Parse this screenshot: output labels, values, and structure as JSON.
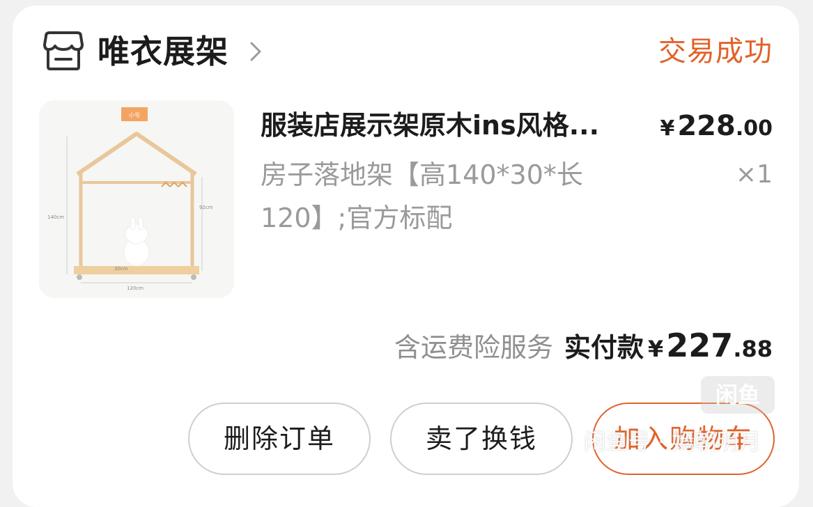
{
  "shop": {
    "name": "唯衣展架",
    "icon": "store-icon"
  },
  "order": {
    "status": "交易成功"
  },
  "product": {
    "thumbnail_tag": "小号",
    "dim_140": "140cm",
    "dim_92": "92cm",
    "dim_30": "30cm",
    "dim_120": "120cm",
    "title": "服装店展示架原木ins风格...",
    "price_symbol": "¥",
    "price_int": "228",
    "price_dec": ".00",
    "spec": "房子落地架【高140*30*长120】;官方标配",
    "quantity": "×1"
  },
  "summary": {
    "service_note": "含运费险服务",
    "paid_label": "实付款",
    "paid_symbol": "¥",
    "paid_int": "227",
    "paid_dec": ".88"
  },
  "actions": {
    "delete": "删除订单",
    "sell": "卖了换钱",
    "add_to_cart": "加入购物车"
  },
  "watermark": {
    "badge": "闲鱼",
    "text": "闲鱼号 · 嫣朝明月"
  },
  "colors": {
    "accent": "#e0632a",
    "text": "#1c1c1c",
    "muted": "#9a9a9a"
  }
}
